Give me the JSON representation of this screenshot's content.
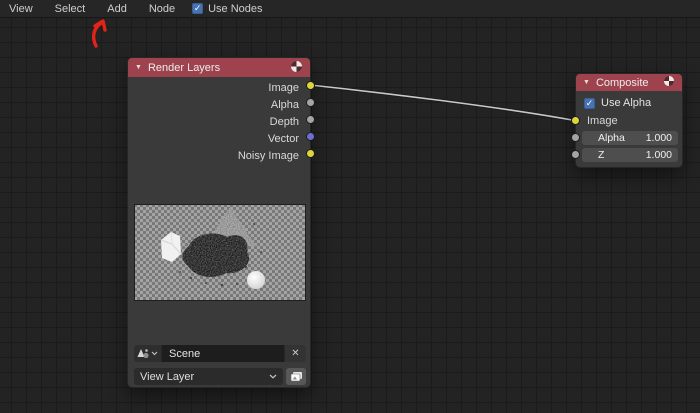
{
  "menu_bar": {
    "items": [
      "View",
      "Select",
      "Add",
      "Node"
    ],
    "use_nodes": {
      "label": "Use Nodes",
      "checked": true,
      "check_glyph": "✓"
    }
  },
  "annotation": {
    "name": "red-arrow",
    "color": "#e2231a"
  },
  "render_layers_node": {
    "title": "Render Layers",
    "collapse_glyph": "▼",
    "outputs": [
      {
        "label": "Image",
        "color": "#ddd53a"
      },
      {
        "label": "Alpha",
        "color": "#a5a5a5"
      },
      {
        "label": "Depth",
        "color": "#a5a5a5"
      },
      {
        "label": "Vector",
        "color": "#6e6ed0"
      },
      {
        "label": "Noisy Image",
        "color": "#ddd53a"
      }
    ],
    "scene_field": {
      "value": "Scene",
      "clear_glyph": "✕"
    },
    "view_layer_field": {
      "value": "View Layer"
    }
  },
  "composite_node": {
    "title": "Composite",
    "collapse_glyph": "▼",
    "use_alpha": {
      "label": "Use Alpha",
      "checked": true,
      "check_glyph": "✓"
    },
    "inputs": [
      {
        "label": "Image",
        "color": "#ddd53a"
      }
    ],
    "number_fields": [
      {
        "label": "Alpha",
        "value": "1.000",
        "socket_color": "#a5a5a5"
      },
      {
        "label": "Z",
        "value": "1.000",
        "socket_color": "#a5a5a5"
      }
    ]
  },
  "colors": {
    "header_red": "#9e434d",
    "accent_blue": "#4772b3",
    "noodle": "#cccccc",
    "canvas_bg": "#232323"
  }
}
